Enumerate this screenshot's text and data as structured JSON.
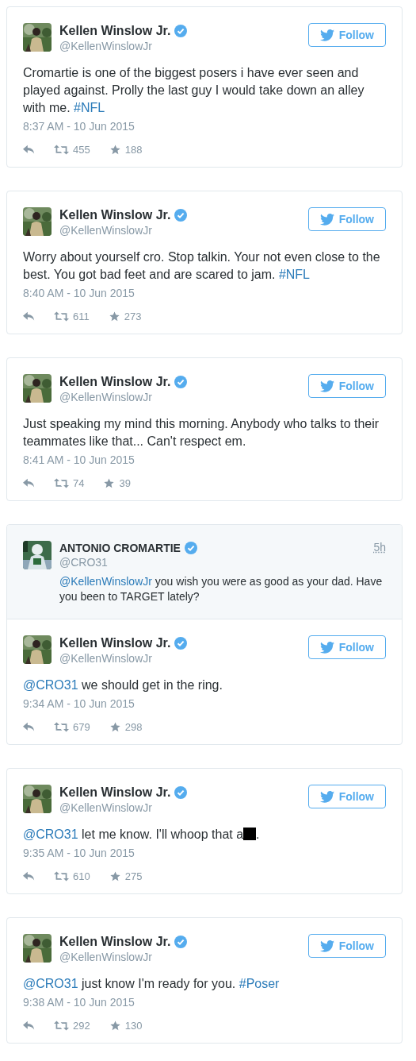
{
  "tweets": [
    {
      "author": {
        "name": "Kellen Winslow Jr.",
        "handle": "@KellenWinslowJr",
        "verified": true
      },
      "follow_label": "Follow",
      "text": [
        {
          "kind": "text",
          "text": "Cromartie is one of the biggest posers i have ever seen and played against. Prolly the last guy I would take down an alley with me. "
        },
        {
          "kind": "link",
          "text": "#NFL"
        }
      ],
      "time": "8:37 AM - 10 Jun 2015",
      "retweets": "455",
      "likes": "188"
    },
    {
      "author": {
        "name": "Kellen Winslow Jr.",
        "handle": "@KellenWinslowJr",
        "verified": true
      },
      "follow_label": "Follow",
      "text": [
        {
          "kind": "text",
          "text": "Worry about yourself cro. Stop talkin. Your not even close to the best. You got bad feet and are scared to jam. "
        },
        {
          "kind": "link",
          "text": "#NFL"
        }
      ],
      "time": "8:40 AM - 10 Jun 2015",
      "retweets": "611",
      "likes": "273"
    },
    {
      "author": {
        "name": "Kellen Winslow Jr.",
        "handle": "@KellenWinslowJr",
        "verified": true
      },
      "follow_label": "Follow",
      "text": [
        {
          "kind": "text",
          "text": "Just speaking my mind this morning. Anybody who talks to their teammates like that... Can't respect em."
        }
      ],
      "time": "8:41 AM - 10 Jun 2015",
      "retweets": "74",
      "likes": "39"
    },
    {
      "in_reply_to": {
        "author": {
          "name": "ANTONIO CROMARTIE",
          "handle": "@CRO31",
          "verified": true
        },
        "age": "5h",
        "text": [
          {
            "kind": "link",
            "text": "@KellenWinslowJr"
          },
          {
            "kind": "text",
            "text": " you wish you were as good as your dad. Have you been to TARGET lately?"
          }
        ]
      },
      "author": {
        "name": "Kellen Winslow Jr.",
        "handle": "@KellenWinslowJr",
        "verified": true
      },
      "follow_label": "Follow",
      "text": [
        {
          "kind": "link",
          "text": "@CRO31"
        },
        {
          "kind": "text",
          "text": " we should get in the ring."
        }
      ],
      "time": "9:34 AM - 10 Jun 2015",
      "retweets": "679",
      "likes": "298"
    },
    {
      "author": {
        "name": "Kellen Winslow Jr.",
        "handle": "@KellenWinslowJr",
        "verified": true
      },
      "follow_label": "Follow",
      "text": [
        {
          "kind": "link",
          "text": "@CRO31"
        },
        {
          "kind": "text",
          "text": " let me know. I'll whoop that a"
        },
        {
          "kind": "redacted"
        },
        {
          "kind": "text",
          "text": "."
        }
      ],
      "time": "9:35 AM - 10 Jun 2015",
      "retweets": "610",
      "likes": "275"
    },
    {
      "author": {
        "name": "Kellen Winslow Jr.",
        "handle": "@KellenWinslowJr",
        "verified": true
      },
      "follow_label": "Follow",
      "text": [
        {
          "kind": "link",
          "text": "@CRO31"
        },
        {
          "kind": "text",
          "text": " just know I'm ready for you. "
        },
        {
          "kind": "link",
          "text": "#Poser"
        }
      ],
      "time": "9:38 AM - 10 Jun 2015",
      "retweets": "292",
      "likes": "130"
    }
  ]
}
